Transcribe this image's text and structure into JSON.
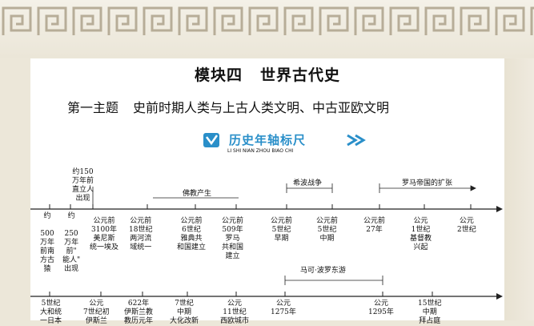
{
  "module": {
    "title_a": "模块四",
    "title_b": "世界古代史"
  },
  "theme": {
    "label": "第一主题",
    "text": "史前时期人类与上古人类文明、中古亚欧文明"
  },
  "ruler": {
    "title": "历史年轴标尺",
    "pinyin": "LI SHI NIAN ZHOU BIAO CHI",
    "accent": "#2a8fc9"
  },
  "timeline1": {
    "spans": [
      "佛教产生",
      "希波战争",
      "罗马帝国的扩张"
    ],
    "above": [
      "约150\n万年前\n直立人\n出现"
    ],
    "events": [
      "约\n\n500\n万年\n前南\n方古\n猿",
      "约\n\n250\n万年\n前\"\n能人\"\n出现",
      "公元前\n3100年\n美尼斯\n统一埃及",
      "公元前\n18世纪\n两河流\n域统一",
      "公元前\n6世纪\n雅典共\n和国建立",
      "公元前\n509年\n罗马\n共和国\n建立",
      "公元前\n5世纪\n早期",
      "公元前\n5世纪\n中期",
      "公元前\n27年",
      "公元\n1世纪\n基督教\n兴起",
      "公元\n2世纪"
    ]
  },
  "timeline2": {
    "spans": [
      "马可·波罗东游"
    ],
    "events": [
      "5世纪\n大和统\n一日本",
      "公元\n7世纪初\n伊斯兰",
      "622年\n伊斯兰教\n教历元年",
      "7世纪\n中期\n大化改新",
      "公元\n11世纪\n西欧城市",
      "公元\n1275年",
      "公元\n1295年",
      "15世纪\n中期\n拜占庭"
    ]
  }
}
